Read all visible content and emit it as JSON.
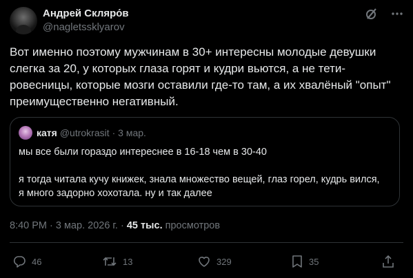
{
  "author": {
    "display_name": "Андрей Скляро́в",
    "handle": "@nagletssklyarov"
  },
  "tweet": {
    "text": "Вот именно поэтому мужчинам в 30+ интересны молодые девушки\nслегка за 20, у которых глаза горят и кудри вьются, а не тети-\nровесницы, которые мозги оставили где-то там, а их хвалёный \"опыт\"\nпреимущественно негативный."
  },
  "quote": {
    "name": "катя",
    "handle": "@utrokrasit",
    "date": "· 3 мар.",
    "line1": "мы все были гораздо интереснее в 16-18 чем в 30-40",
    "line2": "я тогда читала кучу книжек, знала множество вещей, глаз горел, кудрь вился,\nя много задорно хохотала. ну и так далее"
  },
  "meta": {
    "time": "8:40 PM · 3 мар. 2026 г. · ",
    "views_count": "45 тыс.",
    "views_label": "просмотров"
  },
  "actions": {
    "replies": "46",
    "reposts": "13",
    "likes": "329",
    "bookmarks": "35"
  },
  "icons": {
    "grok": "slashed-circle-icon",
    "more": "more-icon",
    "reply": "reply-icon",
    "repost": "repost-icon",
    "like": "like-icon",
    "bookmark": "bookmark-icon",
    "share": "share-icon"
  },
  "colors": {
    "background": "#000000",
    "text": "#e7e9ea",
    "secondary": "#71767b",
    "border": "#2f3336"
  }
}
